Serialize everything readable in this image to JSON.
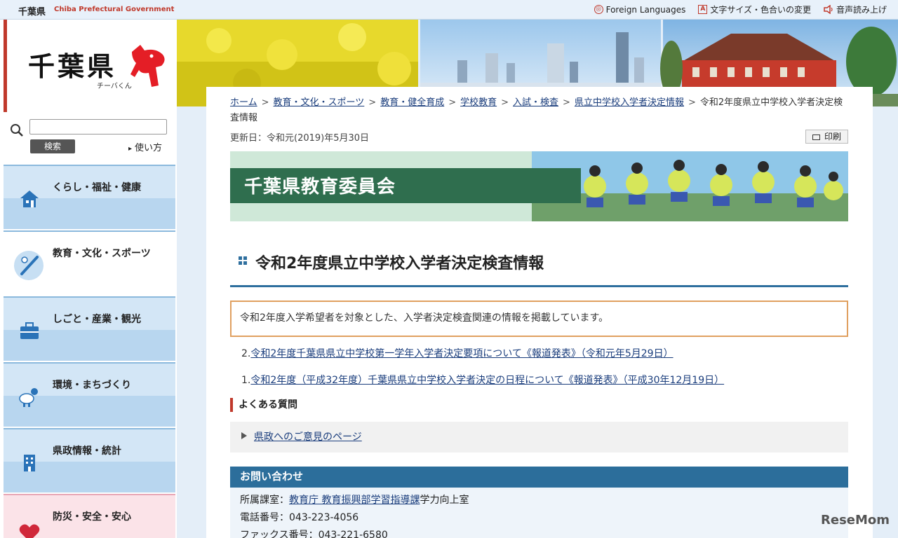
{
  "topbar": {
    "brand": "千葉県",
    "brand_en": "Chiba Prefectural Government",
    "tools": [
      {
        "label": "Foreign Languages",
        "icon": "globe-icon"
      },
      {
        "label": "文字サイズ・色合いの変更",
        "icon": "text-size-icon"
      },
      {
        "label": "音声読み上げ",
        "icon": "speaker-icon"
      }
    ]
  },
  "logo": {
    "title": "千葉県",
    "mascot": "チーバくん"
  },
  "search": {
    "placeholder": "",
    "button": "検索",
    "howto": "使い方"
  },
  "nav": [
    {
      "label": "くらし・福祉・健康",
      "icon": "house-icon"
    },
    {
      "label": "教育・文化・スポーツ",
      "icon": "baseball-bat-icon"
    },
    {
      "label": "しごと・産業・観光",
      "icon": "briefcase-icon"
    },
    {
      "label": "環境・まちづくり",
      "icon": "weather-icon"
    },
    {
      "label": "県政情報・統計",
      "icon": "building-icon"
    },
    {
      "label": "防災・安全・安心",
      "icon": "heart-icon"
    }
  ],
  "breadcrumb": {
    "links": [
      "ホーム",
      "教育・文化・スポーツ",
      "教育・健全育成",
      "学校教育",
      "入試・検査",
      "県立中学校入学者決定情報"
    ],
    "current": "令和2年度県立中学校入学者決定検査情報"
  },
  "updated": "更新日：令和元(2019)年5月30日",
  "print": "印刷",
  "hero_title": "千葉県教育委員会",
  "page_title": "令和2年度県立中学校入学者決定検査情報",
  "notice": "令和2年度入学希望者を対象とした、入学者決定検査関連の情報を掲載しています。",
  "links": [
    {
      "num": "2.",
      "text": "令和2年度千葉県県立中学校第一学年入学者決定要項について《報道発表》（令和元年5月29日）"
    },
    {
      "num": "1.",
      "text": "令和2年度（平成32年度）千葉県県立中学校入学者決定の日程について《報道発表》（平成30年12月19日）"
    }
  ],
  "faq": {
    "heading": "よくある質問",
    "link": "県政へのご意見のページ"
  },
  "contact": {
    "heading": "お問い合わせ",
    "dept_label": "所属課室：",
    "dept_link": "教育庁 教育振興部学習指導課",
    "dept_suffix": "学力向上室",
    "tel": "電話番号：043-223-4056",
    "fax": "ファックス番号：043-221-6580"
  },
  "watermark": "ReseMom",
  "colors": {
    "accent_red": "#c0392b",
    "nav_blue": "#b8d6ef",
    "contact_blue": "#2c6e9b",
    "hero_green": "#2f6e4e"
  }
}
